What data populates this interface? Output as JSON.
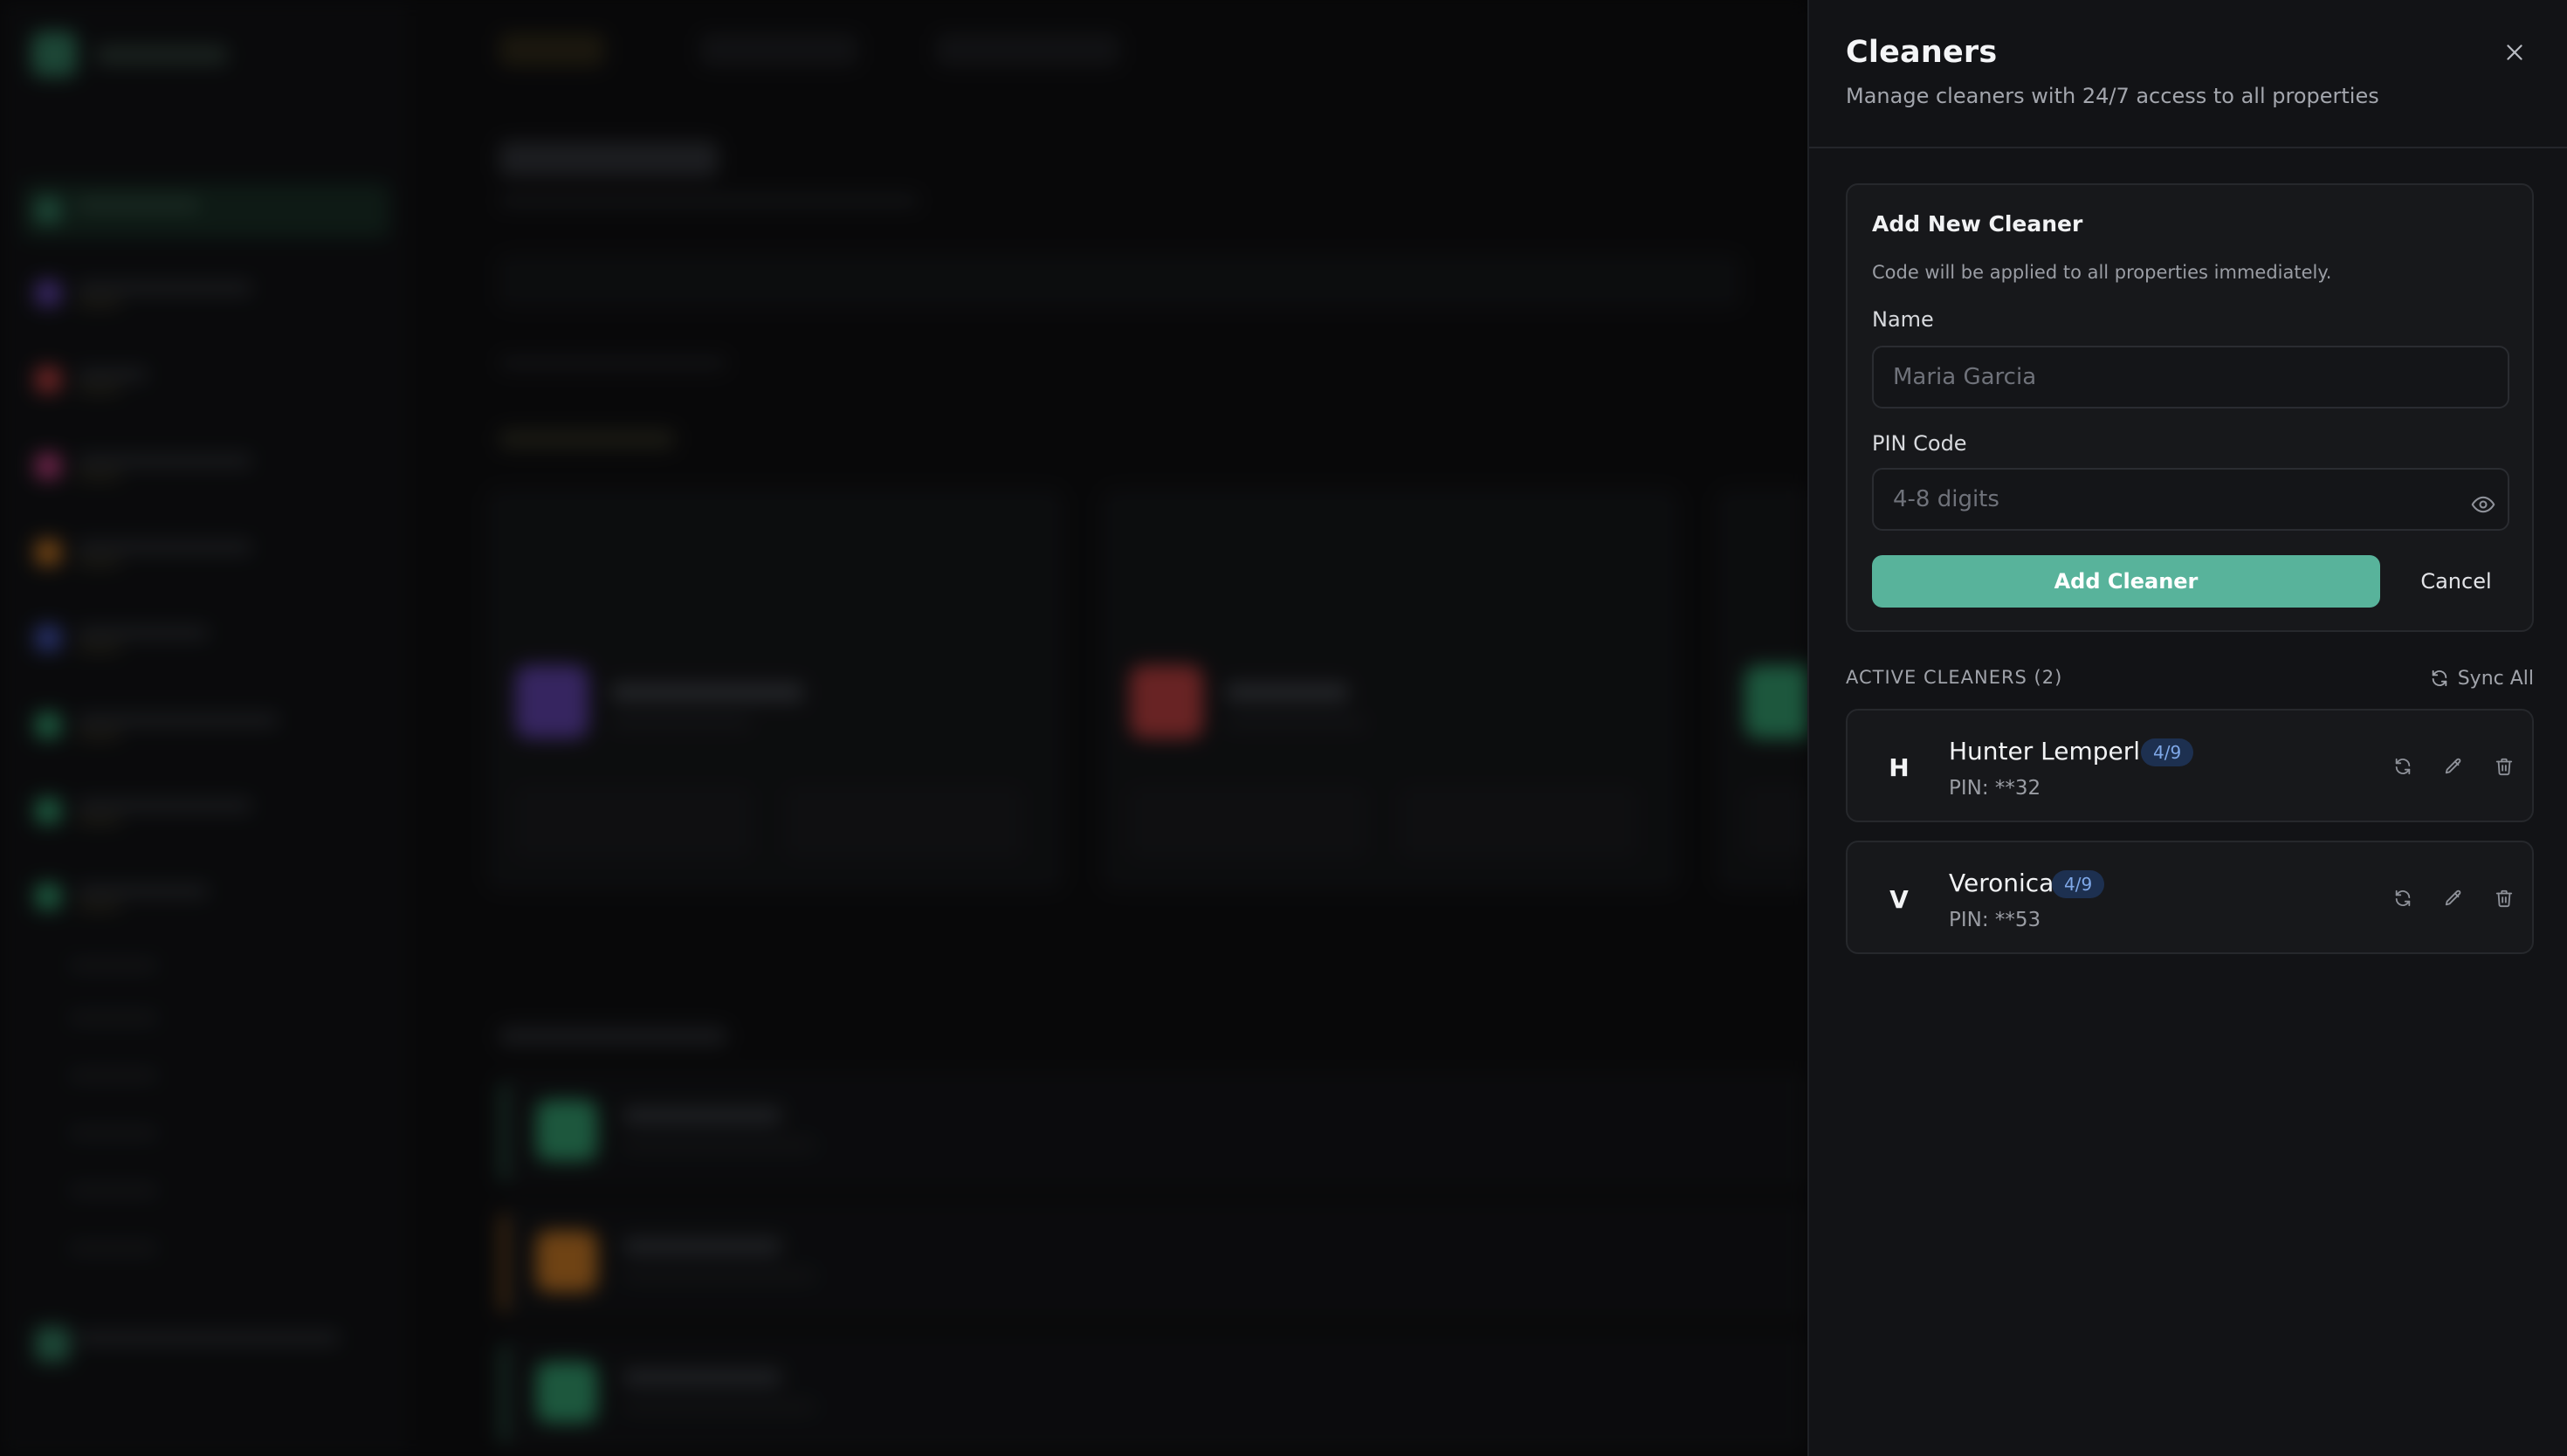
{
  "drawer": {
    "title": "Cleaners",
    "subtitle": "Manage cleaners with 24/7 access to all properties"
  },
  "add_form": {
    "title": "Add New Cleaner",
    "note": "Code will be applied to all properties immediately.",
    "name_label": "Name",
    "name_placeholder": "Maria Garcia",
    "name_value": "",
    "pin_label": "PIN Code",
    "pin_placeholder": "4-8 digits",
    "pin_value": "",
    "submit_label": "Add Cleaner",
    "cancel_label": "Cancel"
  },
  "active_section": {
    "title": "ACTIVE CLEANERS (2)",
    "sync_label": "Sync All"
  },
  "cleaners": [
    {
      "initial": "H",
      "name": "Hunter Lemperle",
      "badge": "4/9",
      "pin": "PIN: **32"
    },
    {
      "initial": "V",
      "name": "Veronica",
      "badge": "4/9",
      "pin": "PIN: **53"
    }
  ],
  "icons": {
    "close": "close-icon",
    "eye": "eye-icon",
    "sync": "refresh-icon",
    "edit": "pencil-icon",
    "delete": "trash-icon"
  },
  "colors": {
    "accent": "#58b39b",
    "badge_bg": "#1d3050",
    "badge_text": "#7fa8e8",
    "panel_bg": "#121316"
  }
}
